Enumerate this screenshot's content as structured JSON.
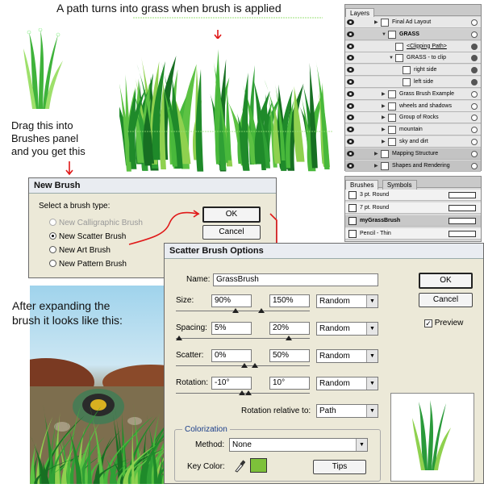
{
  "captions": {
    "top": "A path turns into grass when brush is applied",
    "drag": [
      "Drag this into",
      "Brushes panel",
      "and you get this"
    ],
    "after": [
      "After expanding the",
      "brush it looks like this:"
    ]
  },
  "layers_panel": {
    "tab": "Layers",
    "rows": [
      {
        "name": "Final Ad Layout",
        "level": 0
      },
      {
        "name": "GRASS",
        "level": 1
      },
      {
        "name": "<Clipping Path>",
        "level": 2
      },
      {
        "name": "GRASS - to clip",
        "level": 2
      },
      {
        "name": "right side",
        "level": 3
      },
      {
        "name": "left side",
        "level": 3
      },
      {
        "name": "Grass Brush Example",
        "level": 1
      },
      {
        "name": "wheels and shadows",
        "level": 1
      },
      {
        "name": "Group of Rocks",
        "level": 1
      },
      {
        "name": "mountain",
        "level": 1
      },
      {
        "name": "sky and dirt",
        "level": 1
      },
      {
        "name": "Mapping Structure",
        "level": 0
      },
      {
        "name": "Shapes and Rendering",
        "level": 0
      }
    ]
  },
  "brushes_panel": {
    "tabs": [
      "Brushes",
      "Symbols"
    ],
    "items": [
      "3 pt. Round",
      "7 pt. Round",
      "myGrassBrush",
      "Pencil - Thin"
    ]
  },
  "new_brush": {
    "title": "New Brush",
    "prompt": "Select a brush type:",
    "options": [
      "New Calligraphic Brush",
      "New Scatter Brush",
      "New Art Brush",
      "New Pattern Brush"
    ],
    "selected": "New Scatter Brush",
    "ok": "OK",
    "cancel": "Cancel"
  },
  "scatter": {
    "title": "Scatter Brush Options",
    "name_label": "Name:",
    "name_value": "GrassBrush",
    "ok": "OK",
    "cancel": "Cancel",
    "preview_label": "Preview",
    "preview_checked": true,
    "rows": [
      {
        "label": "Size:",
        "min": "90%",
        "max": "150%",
        "mode": "Random"
      },
      {
        "label": "Spacing:",
        "min": "5%",
        "max": "20%",
        "mode": "Random"
      },
      {
        "label": "Scatter:",
        "min": "0%",
        "max": "50%",
        "mode": "Random"
      },
      {
        "label": "Rotation:",
        "min": "-10°",
        "max": "10°",
        "mode": "Random"
      }
    ],
    "rotation_relative_label": "Rotation relative to:",
    "rotation_relative_value": "Path",
    "colorization_label": "Colorization",
    "method_label": "Method:",
    "method_value": "None",
    "key_color_label": "Key Color:",
    "key_color": "#7dc13a",
    "tips": "Tips"
  },
  "colors": {
    "grass_dark": "#1f8a2a",
    "grass_light": "#8fd14f",
    "accent_red": "#e01818",
    "sky": "#7fbfdc",
    "dirt": "#7a6a4a"
  }
}
